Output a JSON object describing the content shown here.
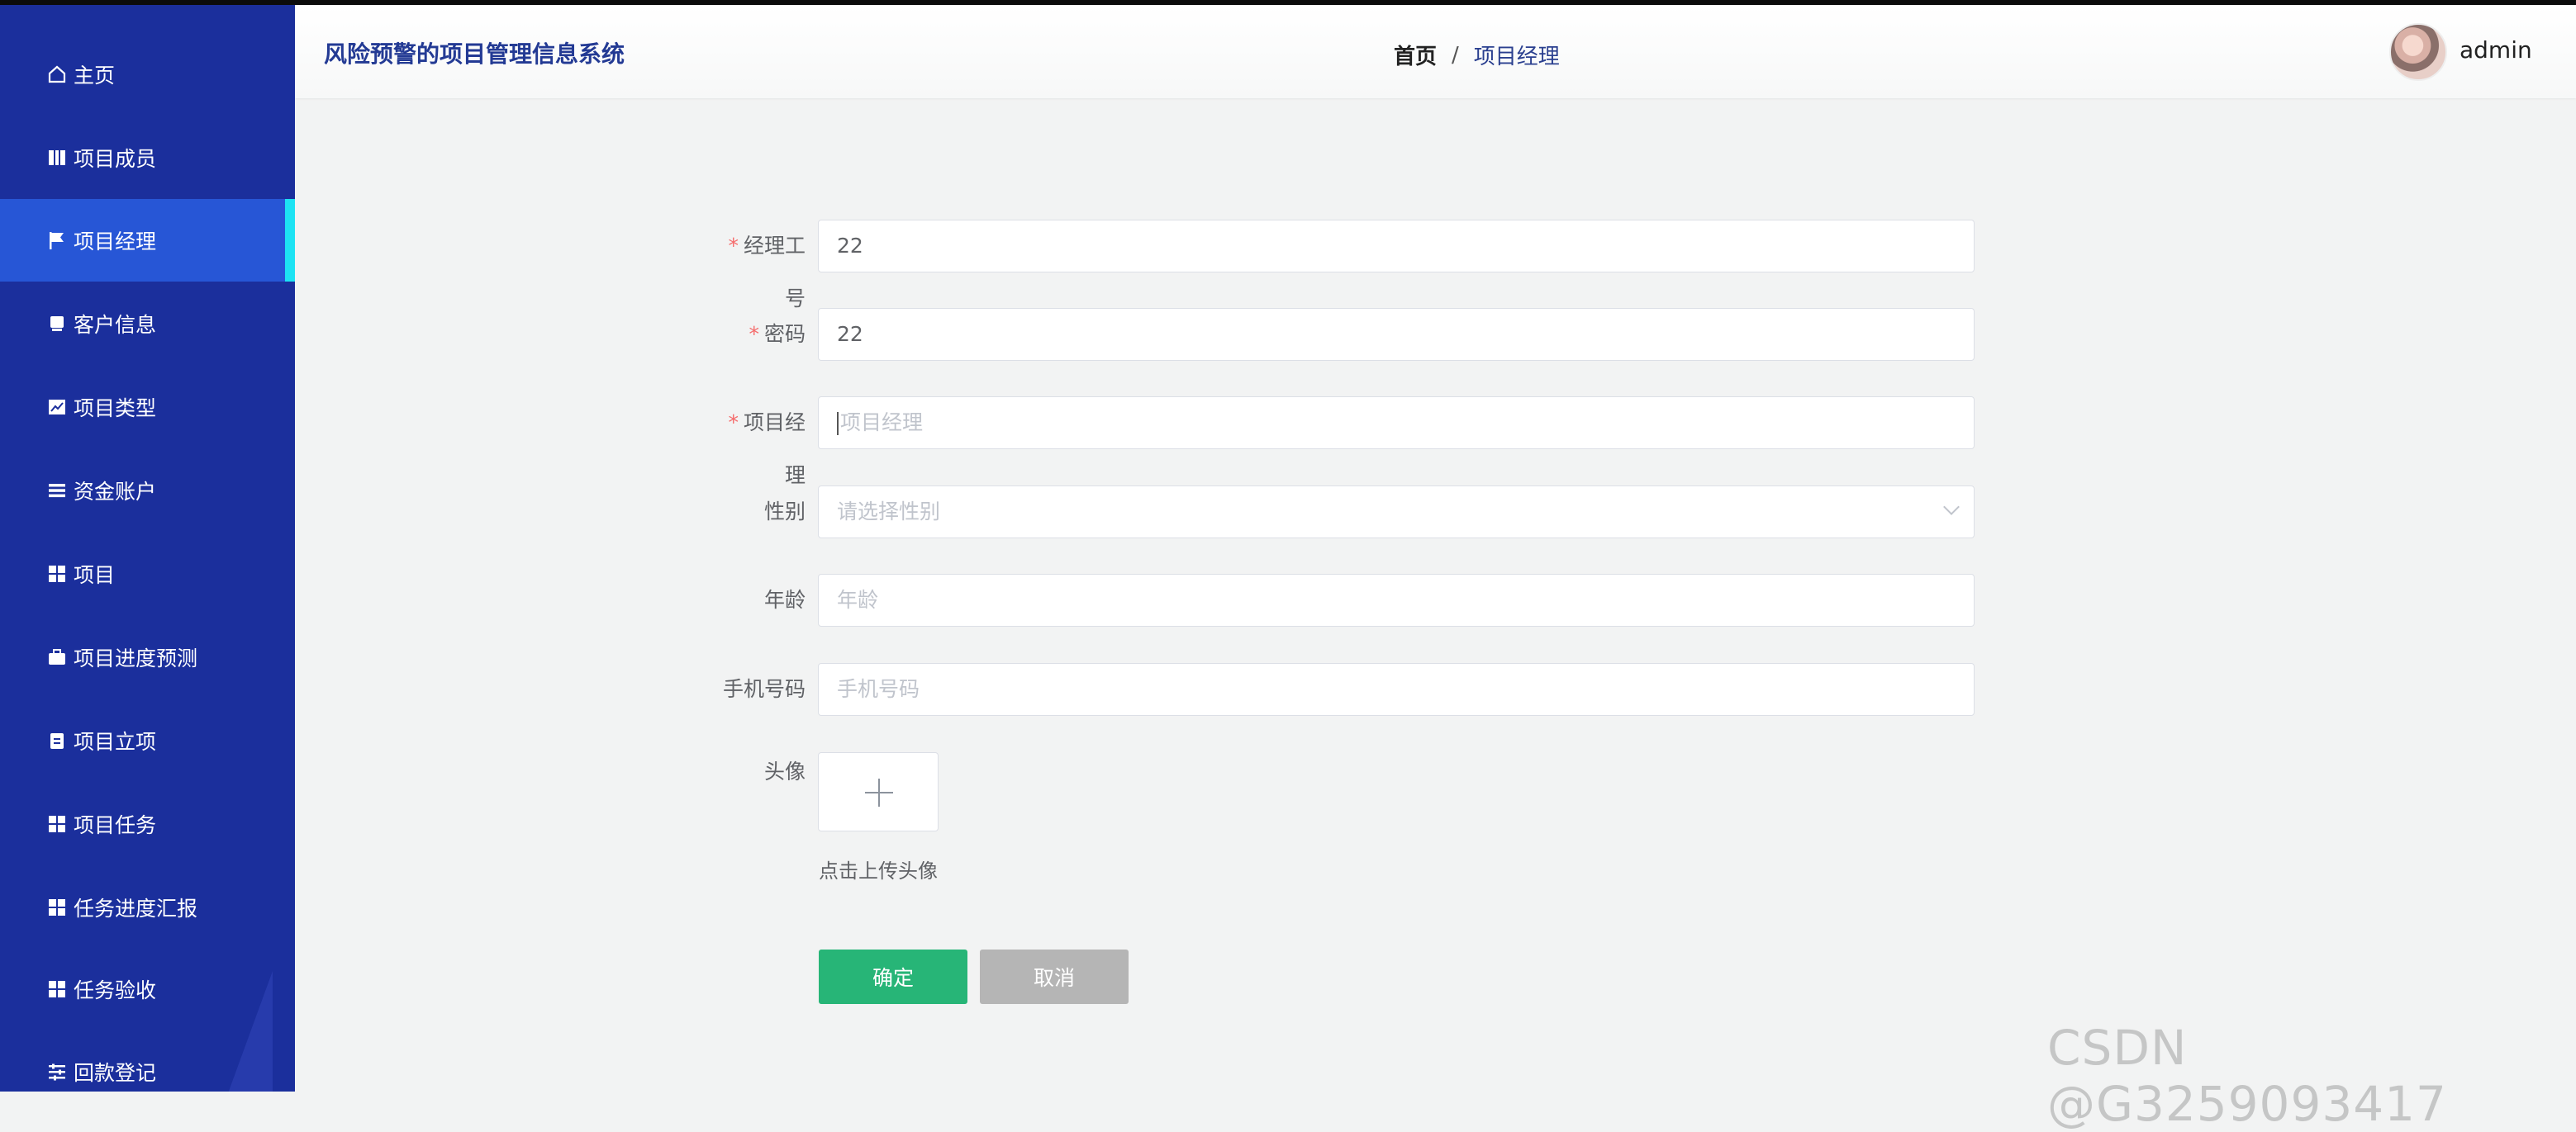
{
  "app": {
    "title": "风险预警的项目管理信息系统"
  },
  "breadcrumb": {
    "home": "首页",
    "separator": "/",
    "current": "项目经理"
  },
  "user": {
    "name": "admin"
  },
  "sidebar": {
    "items": [
      {
        "label": "主页",
        "icon": "home-icon"
      },
      {
        "label": "项目成员",
        "icon": "book-icon"
      },
      {
        "label": "项目经理",
        "icon": "flag-icon",
        "active": true
      },
      {
        "label": "客户信息",
        "icon": "printer-icon"
      },
      {
        "label": "项目类型",
        "icon": "chart-icon"
      },
      {
        "label": "资金账户",
        "icon": "list-icon"
      },
      {
        "label": "项目",
        "icon": "grid-icon"
      },
      {
        "label": "项目进度预测",
        "icon": "briefcase-icon"
      },
      {
        "label": "项目立项",
        "icon": "clipboard-icon"
      },
      {
        "label": "项目任务",
        "icon": "grid-icon"
      },
      {
        "label": "任务进度汇报",
        "icon": "grid-icon"
      },
      {
        "label": "任务验收",
        "icon": "grid-icon"
      },
      {
        "label": "回款登记",
        "icon": "sliders-icon"
      }
    ]
  },
  "form": {
    "manager_id": {
      "label": "经理工号",
      "value": "22",
      "required": true
    },
    "password": {
      "label": "密码",
      "value": "22",
      "required": true
    },
    "manager_name": {
      "label": "项目经理",
      "placeholder": "项目经理",
      "required": true
    },
    "gender": {
      "label": "性别",
      "placeholder": "请选择性别"
    },
    "age": {
      "label": "年龄",
      "placeholder": "年龄"
    },
    "phone": {
      "label": "手机号码",
      "placeholder": "手机号码"
    },
    "avatar": {
      "label": "头像",
      "hint": "点击上传头像"
    }
  },
  "buttons": {
    "confirm": "确定",
    "cancel": "取消"
  },
  "watermark": "CSDN @G3259093417",
  "colors": {
    "sidebar": "#1b2f9c",
    "active": "#2756d6",
    "accent": "#1de3f3",
    "confirm": "#27b577",
    "cancel": "#b5b5b5"
  }
}
